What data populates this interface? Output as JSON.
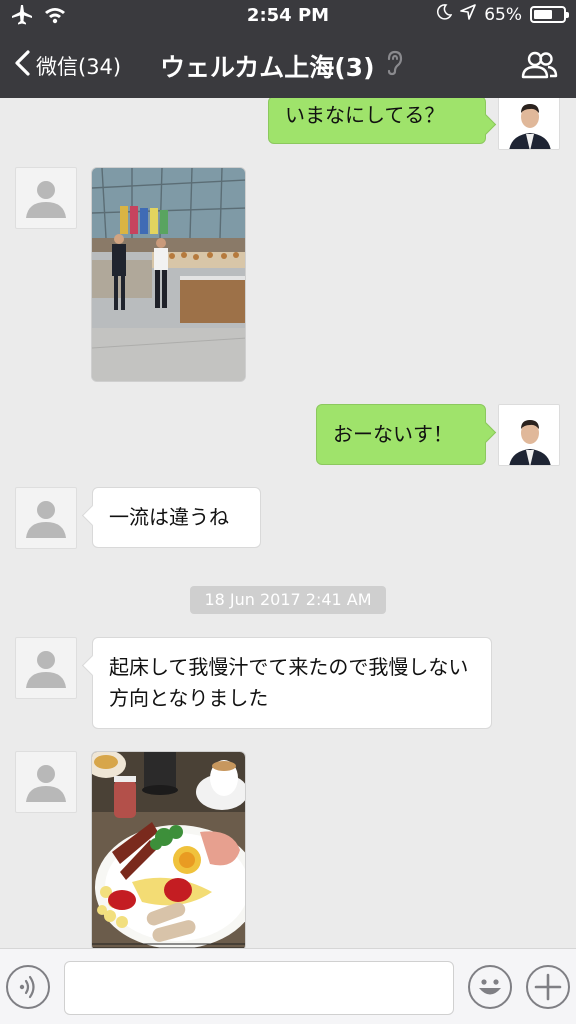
{
  "status_bar": {
    "time": "2:54 PM",
    "battery": "65%",
    "battery_level": 0.65
  },
  "nav": {
    "back_label": "微信(34)",
    "title": "ウェルカム上海(3)"
  },
  "messages": [
    {
      "side": "out",
      "type": "text",
      "text": "いまなにしてる？"
    },
    {
      "side": "in",
      "type": "image",
      "image_subject": "hotel-buffet-lobby"
    },
    {
      "side": "out",
      "type": "text",
      "text": "おーないす！"
    },
    {
      "side": "in",
      "type": "text",
      "text": "一流は違うね"
    },
    {
      "side": "in",
      "type": "text",
      "text": "起床して我慢汁でて来たので我慢しない方向となりました"
    },
    {
      "side": "in",
      "type": "image",
      "image_subject": "breakfast-plate"
    }
  ],
  "timestamp": "18 Jun 2017 2:41 AM",
  "input": {
    "placeholder": ""
  },
  "colors": {
    "nav_bg": "#3a3a3e",
    "chat_bg": "#ebebeb",
    "outgoing_bubble": "#9fe36b",
    "incoming_bubble": "#ffffff"
  },
  "icons": [
    "airplane-icon",
    "wifi-icon",
    "moon-icon",
    "location-arrow-icon",
    "battery-icon",
    "back-chevron-icon",
    "ear-icon",
    "group-members-icon",
    "voice-icon",
    "emoji-icon",
    "plus-icon"
  ]
}
